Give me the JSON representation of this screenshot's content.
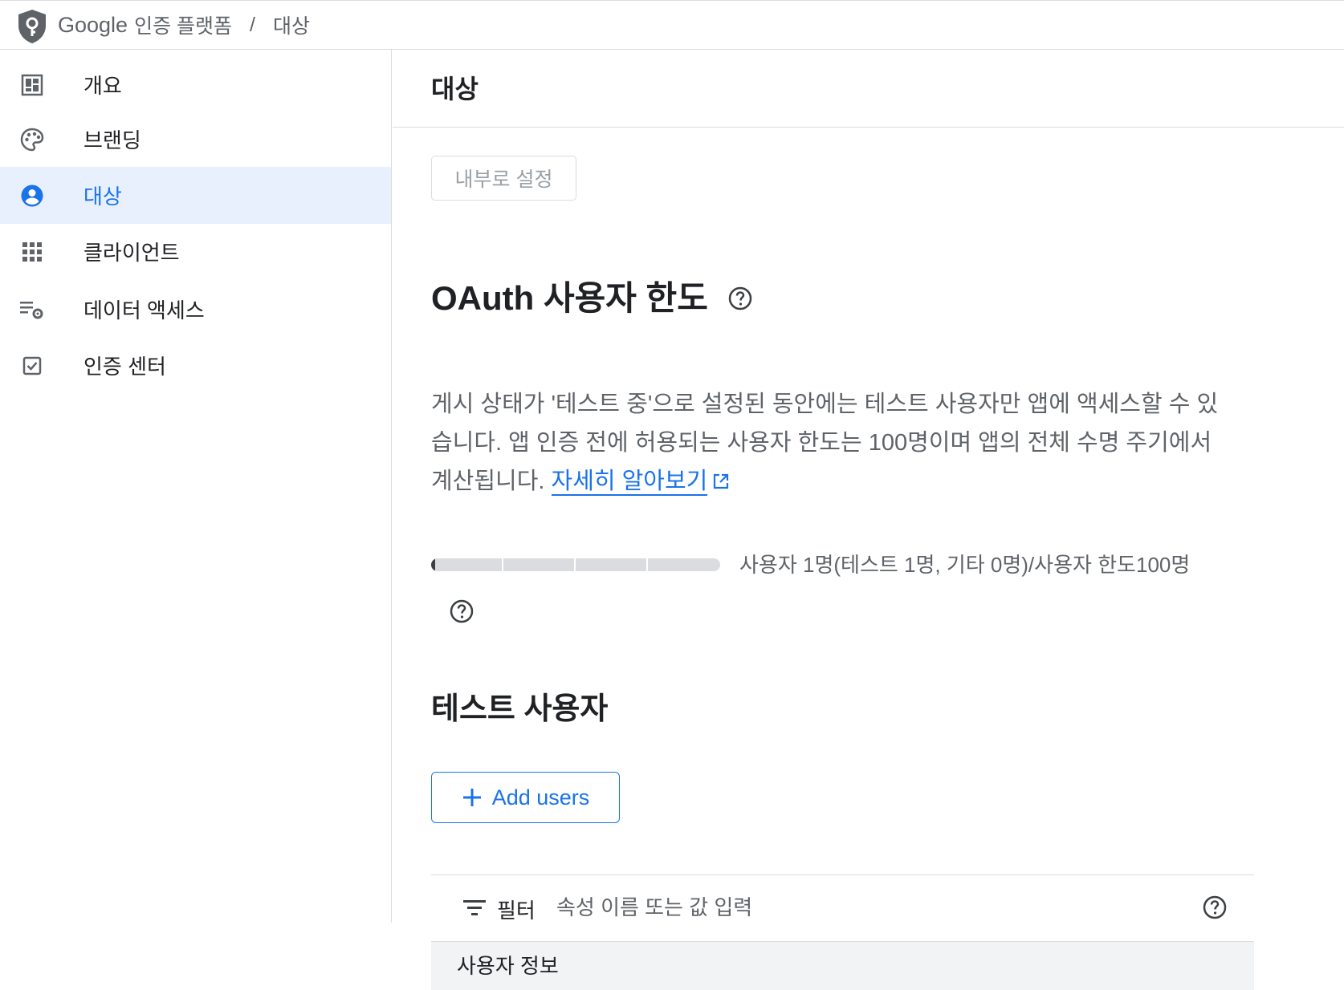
{
  "header": {
    "brand_google": "Google",
    "brand_product": "인증 플랫폼",
    "separator": "/",
    "breadcrumb_current": "대상"
  },
  "sidebar": {
    "items": [
      {
        "label": "개요",
        "icon": "dashboard-icon"
      },
      {
        "label": "브랜딩",
        "icon": "palette-icon"
      },
      {
        "label": "대상",
        "icon": "account-circle-icon",
        "active": true
      },
      {
        "label": "클라이언트",
        "icon": "apps-grid-icon"
      },
      {
        "label": "데이터 액세스",
        "icon": "list-settings-icon"
      },
      {
        "label": "인증 센터",
        "icon": "checkbox-icon"
      }
    ]
  },
  "main": {
    "title": "대상",
    "internal_button": "내부로 설정",
    "oauth_section": {
      "title": "OAuth 사용자 한도",
      "desc_line1": "게시 상태가 '테스트 중'으로 설정된 동안에는 테스트 사용자만 앱에 액세스할 수 있",
      "desc_line2": "습니다. 앱 인증 전에 허용되는 사용자 한도는 100명이며 앱의 전체 수명 주기에서",
      "desc_line3": "계산됩니다.",
      "learn_more": "자세히 알아보기",
      "usage_text": "사용자 1명(테스트 1명, 기타 0명)/사용자 한도100명",
      "usage_fraction": 0.01
    },
    "test_users": {
      "title": "테스트 사용자",
      "add_button": "Add users",
      "filter_label": "필터",
      "filter_placeholder": "속성 이름 또는 값 입력",
      "column_user_info": "사용자 정보"
    }
  },
  "colors": {
    "accent": "#1a73e8",
    "active_bg": "#e8f0fe",
    "border": "#dadce0",
    "text_secondary": "#5f6368"
  }
}
